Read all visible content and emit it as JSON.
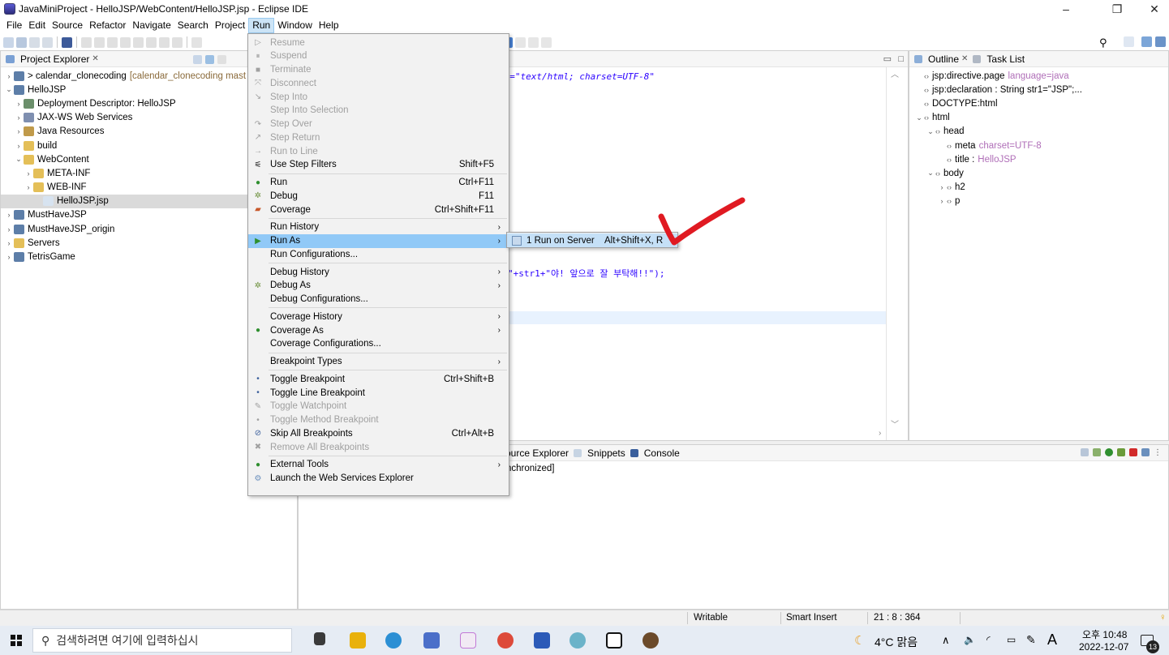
{
  "window": {
    "title": "JavaMiniProject - HelloJSP/WebContent/HelloJSP.jsp - Eclipse IDE",
    "controls": [
      "–",
      "❐",
      "✕"
    ]
  },
  "menubar": [
    "File",
    "Edit",
    "Source",
    "Refactor",
    "Navigate",
    "Search",
    "Project",
    "Run",
    "Window",
    "Help"
  ],
  "project_explorer": {
    "tab_label": "Project Explorer",
    "close": "✕",
    "items": [
      {
        "arrow": "›",
        "label": "> calendar_clonecoding",
        "deco": "[calendar_clonecoding mast",
        "icon": "project-icon"
      },
      {
        "arrow": "⌄",
        "label": "HelloJSP",
        "icon": "project-icon"
      },
      {
        "arrow": "›",
        "label": "Deployment Descriptor: HelloJSP",
        "icon": "descriptor-icon"
      },
      {
        "arrow": "›",
        "label": "JAX-WS Web Services",
        "icon": "webservice-icon"
      },
      {
        "arrow": "›",
        "label": "Java Resources",
        "icon": "java-resources-icon"
      },
      {
        "arrow": "›",
        "label": "build",
        "icon": "folder-icon"
      },
      {
        "arrow": "⌄",
        "label": "WebContent",
        "icon": "folder-icon"
      },
      {
        "arrow": "›",
        "label": "META-INF",
        "icon": "folder-icon"
      },
      {
        "arrow": "›",
        "label": "WEB-INF",
        "icon": "folder-icon"
      },
      {
        "arrow": "",
        "label": "HelloJSP.jsp",
        "icon": "jsp-file-icon"
      },
      {
        "arrow": "›",
        "label": "MustHaveJSP",
        "icon": "project-icon"
      },
      {
        "arrow": "›",
        "label": "MustHaveJSP_origin",
        "icon": "project-icon"
      },
      {
        "arrow": "›",
        "label": "Servers",
        "icon": "folder-icon"
      },
      {
        "arrow": "›",
        "label": "TetrisGame",
        "icon": "project-icon"
      }
    ]
  },
  "editor": {
    "line1": "pe=\"text/html; charset=UTF-8\"",
    "line2": "\"+str1+\"야! 앞으로 잘 부탁해!!\");"
  },
  "outline": {
    "tab_outline": "Outline",
    "tab_tasklist": "Task List",
    "rows": [
      {
        "indent": 0,
        "arrow": "",
        "name": "jsp:directive.page",
        "extra": "language=java"
      },
      {
        "indent": 0,
        "arrow": "",
        "name": "jsp:declaration : String str1=\"JSP\";...",
        "extra": ""
      },
      {
        "indent": 0,
        "arrow": "",
        "name": "DOCTYPE:html",
        "extra": ""
      },
      {
        "indent": 0,
        "arrow": "⌄",
        "name": "html",
        "extra": ""
      },
      {
        "indent": 1,
        "arrow": "⌄",
        "name": "head",
        "extra": ""
      },
      {
        "indent": 2,
        "arrow": "",
        "name": "meta",
        "extra": "charset=UTF-8"
      },
      {
        "indent": 2,
        "arrow": "",
        "name": "title :",
        "extra": "HelloJSP"
      },
      {
        "indent": 1,
        "arrow": "⌄",
        "name": "body",
        "extra": ""
      },
      {
        "indent": 2,
        "arrow": "›",
        "name": "h2",
        "extra": ""
      },
      {
        "indent": 2,
        "arrow": "›",
        "name": "p",
        "extra": ""
      }
    ]
  },
  "console": {
    "tabs": [
      "ource Explorer",
      "Snippets",
      "Console"
    ],
    "line": "nchronized]"
  },
  "run_menu": {
    "items": [
      {
        "label": "Resume",
        "accel": "",
        "disabled": true,
        "sub": false,
        "icon": "▷"
      },
      {
        "label": "Suspend",
        "accel": "",
        "disabled": true,
        "sub": false,
        "icon": "⏸"
      },
      {
        "label": "Terminate",
        "accel": "",
        "disabled": true,
        "sub": false,
        "icon": "■"
      },
      {
        "label": "Disconnect",
        "accel": "",
        "disabled": true,
        "sub": false,
        "icon": "⤧"
      },
      {
        "label": "Step Into",
        "accel": "",
        "disabled": true,
        "sub": false,
        "icon": "↘"
      },
      {
        "label": "Step Into Selection",
        "accel": "",
        "disabled": true,
        "sub": false,
        "icon": ""
      },
      {
        "label": "Step Over",
        "accel": "",
        "disabled": true,
        "sub": false,
        "icon": "↷"
      },
      {
        "label": "Step Return",
        "accel": "",
        "disabled": true,
        "sub": false,
        "icon": "↗"
      },
      {
        "label": "Run to Line",
        "accel": "",
        "disabled": true,
        "sub": false,
        "icon": "→"
      },
      {
        "label": "Use Step Filters",
        "accel": "Shift+F5",
        "disabled": false,
        "sub": false,
        "icon": "⚟"
      },
      {
        "label": "Run",
        "accel": "Ctrl+F11",
        "disabled": false,
        "sub": false,
        "icon": "●"
      },
      {
        "label": "Debug",
        "accel": "F11",
        "disabled": false,
        "sub": false,
        "icon": "✲"
      },
      {
        "label": "Coverage",
        "accel": "Ctrl+Shift+F11",
        "disabled": false,
        "sub": false,
        "icon": "▰"
      },
      {
        "label": "Run History",
        "accel": "",
        "disabled": false,
        "sub": true,
        "icon": ""
      },
      {
        "label": "Run As",
        "accel": "",
        "disabled": false,
        "sub": true,
        "icon": "▶",
        "highlight": true
      },
      {
        "label": "Run Configurations...",
        "accel": "",
        "disabled": false,
        "sub": false,
        "icon": ""
      },
      {
        "label": "Debug History",
        "accel": "",
        "disabled": false,
        "sub": true,
        "icon": ""
      },
      {
        "label": "Debug As",
        "accel": "",
        "disabled": false,
        "sub": true,
        "icon": "✲"
      },
      {
        "label": "Debug Configurations...",
        "accel": "",
        "disabled": false,
        "sub": false,
        "icon": ""
      },
      {
        "label": "Coverage History",
        "accel": "",
        "disabled": false,
        "sub": true,
        "icon": ""
      },
      {
        "label": "Coverage As",
        "accel": "",
        "disabled": false,
        "sub": true,
        "icon": "●"
      },
      {
        "label": "Coverage Configurations...",
        "accel": "",
        "disabled": false,
        "sub": false,
        "icon": ""
      },
      {
        "label": "Breakpoint Types",
        "accel": "",
        "disabled": false,
        "sub": true,
        "icon": ""
      },
      {
        "label": "Toggle Breakpoint",
        "accel": "Ctrl+Shift+B",
        "disabled": false,
        "sub": false,
        "icon": "•"
      },
      {
        "label": "Toggle Line Breakpoint",
        "accel": "",
        "disabled": false,
        "sub": false,
        "icon": "•"
      },
      {
        "label": "Toggle Watchpoint",
        "accel": "",
        "disabled": true,
        "sub": false,
        "icon": "✎"
      },
      {
        "label": "Toggle Method Breakpoint",
        "accel": "",
        "disabled": true,
        "sub": false,
        "icon": "•"
      },
      {
        "label": "Skip All Breakpoints",
        "accel": "Ctrl+Alt+B",
        "disabled": false,
        "sub": false,
        "icon": "⊘"
      },
      {
        "label": "Remove All Breakpoints",
        "accel": "",
        "disabled": true,
        "sub": false,
        "icon": "✖"
      },
      {
        "label": "External Tools",
        "accel": "",
        "disabled": false,
        "sub": true,
        "icon": "●"
      },
      {
        "label": "Launch the Web Services Explorer",
        "accel": "",
        "disabled": false,
        "sub": false,
        "icon": "⚙"
      }
    ]
  },
  "submenu": {
    "label": "1 Run on Server",
    "accel": "Alt+Shift+X, R"
  },
  "statusbar": {
    "writable": "Writable",
    "insert": "Smart Insert",
    "position": "21 : 8 : 364"
  },
  "taskbar": {
    "search_placeholder": "검색하려면 여기에 입력하십시",
    "weather": "4°C 맑음",
    "lang": "A",
    "time": "오후 10:48",
    "date": "2022-12-07",
    "notif_count": "13"
  },
  "colors": {
    "accent": "#91c9f7",
    "annotation": "#e01a22"
  }
}
